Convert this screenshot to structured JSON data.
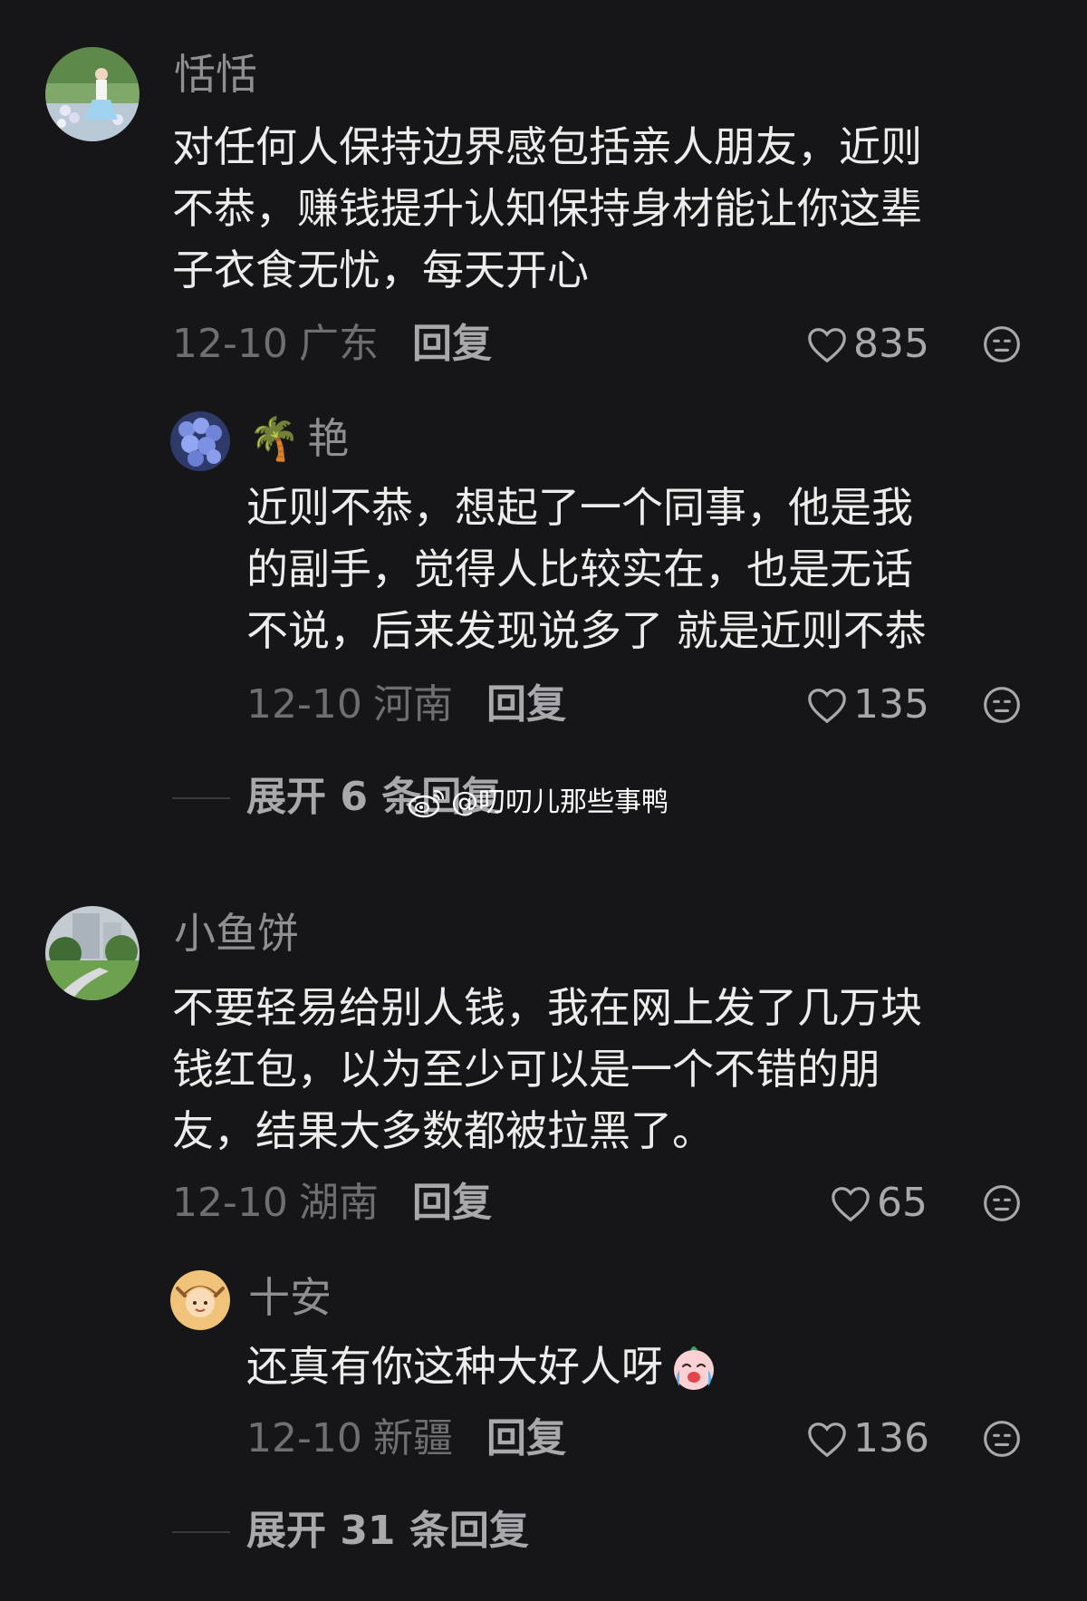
{
  "comments": [
    {
      "username": "恬恬",
      "lines": [
        "对任何人保持边界感包括亲人朋友，近则",
        "不恭，赚钱提升认知保持身材能让你这辈",
        "子衣食无忧，每天开心"
      ],
      "date": "12-10",
      "location": "广东",
      "reply_label": "回复",
      "likes": "835",
      "replies": [
        {
          "username": "艳",
          "username_prefix_emoji": "🌴",
          "lines": [
            "近则不恭，想起了一个同事，他是我",
            "的副手，觉得人比较实在，也是无话",
            "不说，后来发现说多了  就是近则不恭"
          ],
          "date": "12-10",
          "location": "河南",
          "reply_label": "回复",
          "likes": "135"
        }
      ],
      "expand_label": "展开 6 条回复"
    },
    {
      "username": "小鱼饼",
      "lines": [
        "不要轻易给别人钱，我在网上发了几万块",
        "钱红包，以为至少可以是一个不错的朋",
        "友，结果大多数都被拉黑了。"
      ],
      "date": "12-10",
      "location": "湖南",
      "reply_label": "回复",
      "likes": "65",
      "replies": [
        {
          "username": "十安",
          "lines": [
            "还真有你这种大好人呀"
          ],
          "date": "12-10",
          "location": "新疆",
          "reply_label": "回复",
          "likes": "136"
        }
      ],
      "expand_label": "展开 31 条回复"
    }
  ],
  "watermark": "@叨叨儿那些事鸭",
  "colors": {
    "background": "#161618",
    "text_primary": "#ececec",
    "text_secondary": "#8e8e93",
    "text_meta": "#6e6e73",
    "action": "#a8a8ad"
  },
  "icons": [
    "heart-icon",
    "dislike-face-icon",
    "weibo-logo-icon",
    "crying-face-emoji"
  ]
}
